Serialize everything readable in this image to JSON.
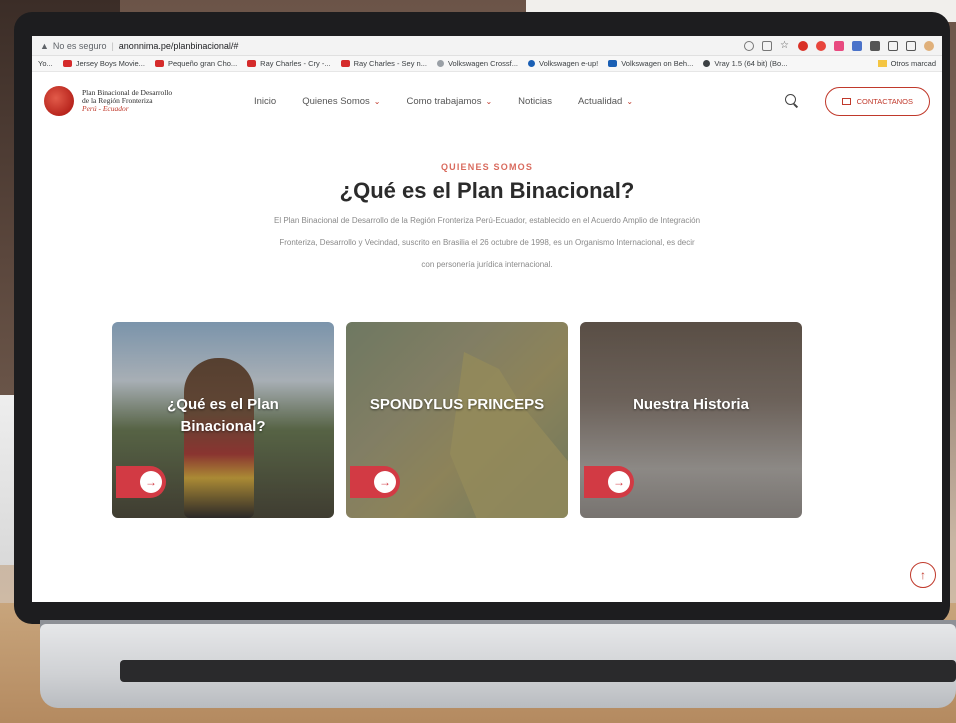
{
  "browser": {
    "security_label": "No es seguro",
    "url": "anonnima.pe/planbinacional/#",
    "bookmarks": [
      {
        "label": "Yo...",
        "color": "#ffffff"
      },
      {
        "label": "Jersey Boys Movie...",
        "color": "#d52b2b"
      },
      {
        "label": "Pequeño gran Cho...",
        "color": "#d52b2b"
      },
      {
        "label": "Ray Charles - Cry -...",
        "color": "#d52b2b"
      },
      {
        "label": "Ray Charles - Sey n...",
        "color": "#d52b2b"
      },
      {
        "label": "Volkswagen Crossf...",
        "color": "#9aa0a6"
      },
      {
        "label": "Volkswagen e-up!",
        "color": "#1a5fb4"
      },
      {
        "label": "Volkswagen on Beh...",
        "color": "#1a5fb4"
      },
      {
        "label": "Vray 1.5 (64 bit) (Bo...",
        "color": "#3c4043"
      }
    ],
    "bookmarks_more": "Otros marcad"
  },
  "site": {
    "logo": {
      "line1": "Plan Binacional de Desarrollo",
      "line2": "de la Región Fronteriza",
      "line3": "Perú - Ecuador"
    },
    "nav": [
      {
        "label": "Inicio",
        "dropdown": false
      },
      {
        "label": "Quienes Somos",
        "dropdown": true
      },
      {
        "label": "Como trabajamos",
        "dropdown": true
      },
      {
        "label": "Noticias",
        "dropdown": false
      },
      {
        "label": "Actualidad",
        "dropdown": true
      }
    ],
    "contact_label": "CONTACTANOS",
    "accent_color": "#c0392b"
  },
  "intro": {
    "kicker": "QUIENES SOMOS",
    "title": "¿Qué es el Plan Binacional?",
    "description": "El Plan Binacional de Desarrollo de la Región Fronteriza Perú-Ecuador, establecido en el Acuerdo Amplio de Integración Fronteriza, Desarrollo y Vecindad, suscrito en Brasilia el 26 octubre de 1998, es un Organismo Internacional, es decir con personería jurídica internacional."
  },
  "cards": [
    {
      "title": "¿Qué es el Plan Binacional?"
    },
    {
      "title": "SPONDYLUS PRINCEPS"
    },
    {
      "title": "Nuestra Historia"
    }
  ]
}
